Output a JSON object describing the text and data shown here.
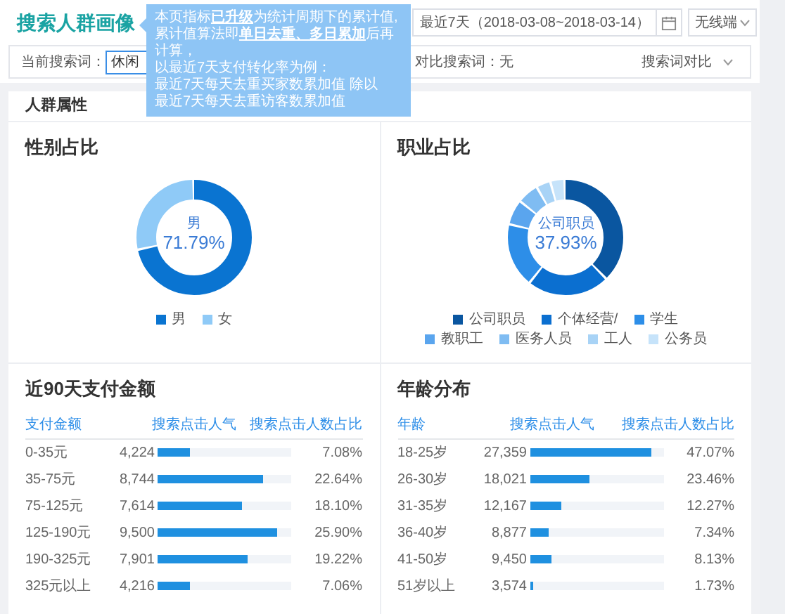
{
  "header": {
    "title": "搜索人群画像",
    "date_range": "最近7天（2018-03-08~2018-03-14）",
    "device": "无线端"
  },
  "tooltip": {
    "lines": [
      "本页指标**已升级**为统计周期下的累计值,",
      "累计值算法即**单日去重、多日累加**后再计算，",
      "以最近7天支付转化率为例：",
      "最近7天每天去重买家数累加值 除以",
      "最近7天每天去重访客数累加值"
    ]
  },
  "filter": {
    "current_label": "当前搜索词：",
    "current_value": "休闲",
    "compare_text": "对比搜索词：无",
    "compare_button": "搜索词对比"
  },
  "section_title": "人群属性",
  "gender": {
    "title": "性别占比",
    "center_label": "男",
    "center_value": "71.79%",
    "legend": [
      {
        "label": "男",
        "color": "#0a74d1"
      },
      {
        "label": "女",
        "color": "#8fcaf7"
      }
    ]
  },
  "occupation": {
    "title": "职业占比",
    "center_label": "公司职员",
    "center_value": "37.93%",
    "legend": [
      {
        "label": "公司职员",
        "color": "#0a56a0"
      },
      {
        "label": "个体经营/",
        "color": "#0b6fd0"
      },
      {
        "label": "学生",
        "color": "#2d8ee8"
      },
      {
        "label": "教职工",
        "color": "#5aa5ee"
      },
      {
        "label": "医务人员",
        "color": "#7fbcf2"
      },
      {
        "label": "工人",
        "color": "#a8d3f6"
      },
      {
        "label": "公务员",
        "color": "#c6e3fa"
      }
    ]
  },
  "payment_table": {
    "title": "近90天支付金额",
    "columns": [
      "支付金额",
      "搜索点击人气",
      "搜索点击人数占比"
    ],
    "rows": [
      {
        "range": "0-35元",
        "popularity": "4,224",
        "level": 0.24,
        "share": "7.08%"
      },
      {
        "range": "35-75元",
        "popularity": "8,744",
        "level": 0.79,
        "share": "22.64%"
      },
      {
        "range": "75-125元",
        "popularity": "7,614",
        "level": 0.63,
        "share": "18.10%"
      },
      {
        "range": "125-190元",
        "popularity": "9,500",
        "level": 0.89,
        "share": "25.90%"
      },
      {
        "range": "190-325元",
        "popularity": "7,901",
        "level": 0.67,
        "share": "19.22%"
      },
      {
        "range": "325元以上",
        "popularity": "4,216",
        "level": 0.24,
        "share": "7.06%"
      }
    ]
  },
  "age_table": {
    "title": "年龄分布",
    "columns": [
      "年龄",
      "搜索点击人气",
      "搜索点击人数占比"
    ],
    "rows": [
      {
        "range": "18-25岁",
        "popularity": "27,359",
        "level": 0.91,
        "share": "47.07%"
      },
      {
        "range": "26-30岁",
        "popularity": "18,021",
        "level": 0.45,
        "share": "23.46%"
      },
      {
        "range": "31-35岁",
        "popularity": "12,167",
        "level": 0.24,
        "share": "12.27%"
      },
      {
        "range": "36-40岁",
        "popularity": "8,877",
        "level": 0.14,
        "share": "7.34%"
      },
      {
        "range": "41-50岁",
        "popularity": "9,450",
        "level": 0.16,
        "share": "8.13%"
      },
      {
        "range": "51岁以上",
        "popularity": "3,574",
        "level": 0.03,
        "share": "1.73%"
      }
    ]
  }
}
